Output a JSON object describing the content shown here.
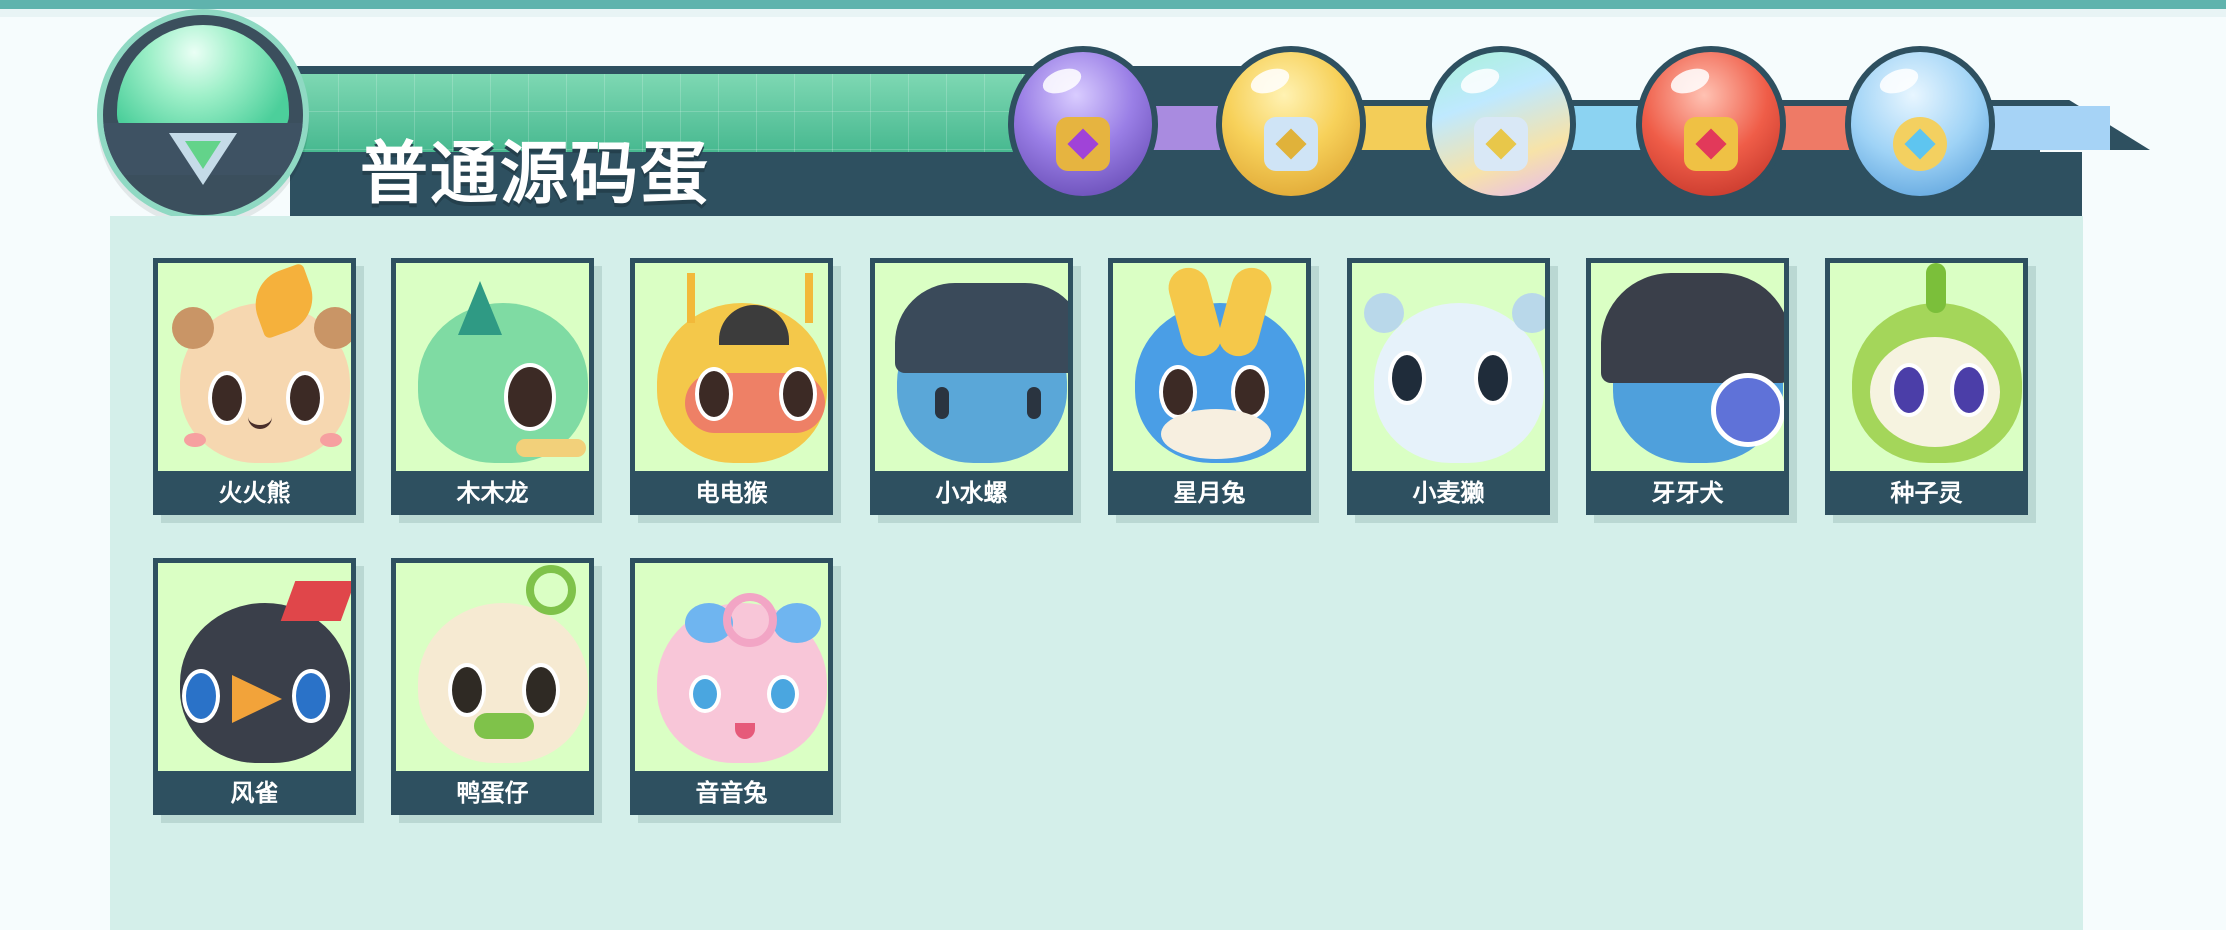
{
  "header": {
    "title": "普通源码蛋"
  },
  "egg_tabs": [
    {
      "name": "purple-egg"
    },
    {
      "name": "gold-egg"
    },
    {
      "name": "rainbow-egg"
    },
    {
      "name": "red-egg"
    },
    {
      "name": "sky-egg"
    }
  ],
  "pets": [
    {
      "name": "火火熊",
      "color": "#f6d7b0",
      "accent": "#f0a23a"
    },
    {
      "name": "木木龙",
      "color": "#7fdba3",
      "accent": "#3fae8a"
    },
    {
      "name": "电电猴",
      "color": "#f4c84a",
      "accent": "#3c3c3c"
    },
    {
      "name": "小水螺",
      "color": "#5aa7d8",
      "accent": "#3c4a5a"
    },
    {
      "name": "星月兔",
      "color": "#4a9ee6",
      "accent": "#f5c84a"
    },
    {
      "name": "小麦獭",
      "color": "#e6f2fa",
      "accent": "#b9d8ea"
    },
    {
      "name": "牙牙犬",
      "color": "#4fa0dc",
      "accent": "#3a3f4a"
    },
    {
      "name": "种子灵",
      "color": "#a4d65a",
      "accent": "#f6f3e0"
    },
    {
      "name": "风雀",
      "color": "#3a3f4a",
      "accent": "#e0464a"
    },
    {
      "name": "鸭蛋仔",
      "color": "#f6ead2",
      "accent": "#7fc24a"
    },
    {
      "name": "音音兔",
      "color": "#f8c6d8",
      "accent": "#6fb5f0"
    }
  ]
}
